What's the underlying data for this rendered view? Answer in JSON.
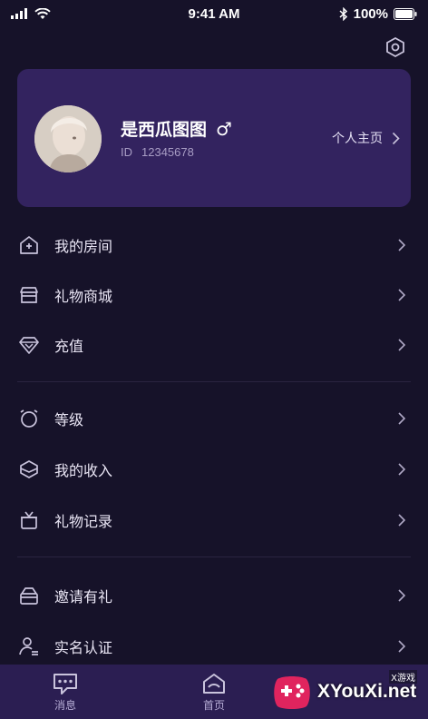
{
  "status_bar": {
    "time": "9:41 AM",
    "battery": "100%",
    "icons": [
      "signal-icon",
      "wifi-icon",
      "bluetooth-icon",
      "battery-icon"
    ]
  },
  "header": {
    "settings_icon": "settings-icon"
  },
  "profile": {
    "name": "是西瓜图图",
    "gender_symbol": "♂",
    "id_label": "ID",
    "id_value": "12345678",
    "homepage_label": "个人主页"
  },
  "menu": {
    "groups": [
      [
        {
          "label": "我的房间",
          "icon": "house-icon"
        },
        {
          "label": "礼物商城",
          "icon": "store-icon"
        },
        {
          "label": "充值",
          "icon": "diamond-icon"
        }
      ],
      [
        {
          "label": "等级",
          "icon": "level-icon"
        },
        {
          "label": "我的收入",
          "icon": "income-icon"
        },
        {
          "label": "礼物记录",
          "icon": "gift-record-icon"
        }
      ],
      [
        {
          "label": "邀请有礼",
          "icon": "invite-icon"
        },
        {
          "label": "实名认证",
          "icon": "verify-user-icon"
        }
      ]
    ]
  },
  "tab_bar": {
    "tabs": [
      {
        "label": "消息",
        "icon": "message-icon"
      },
      {
        "label": "首页",
        "icon": "home-icon"
      }
    ]
  },
  "watermark": {
    "top_text": "X游戏",
    "main_text": "XYouXi.net"
  },
  "colors": {
    "background": "#161229",
    "card": "#33235f",
    "tab_bar": "#2b1e52",
    "text_secondary": "#a89dc4"
  }
}
